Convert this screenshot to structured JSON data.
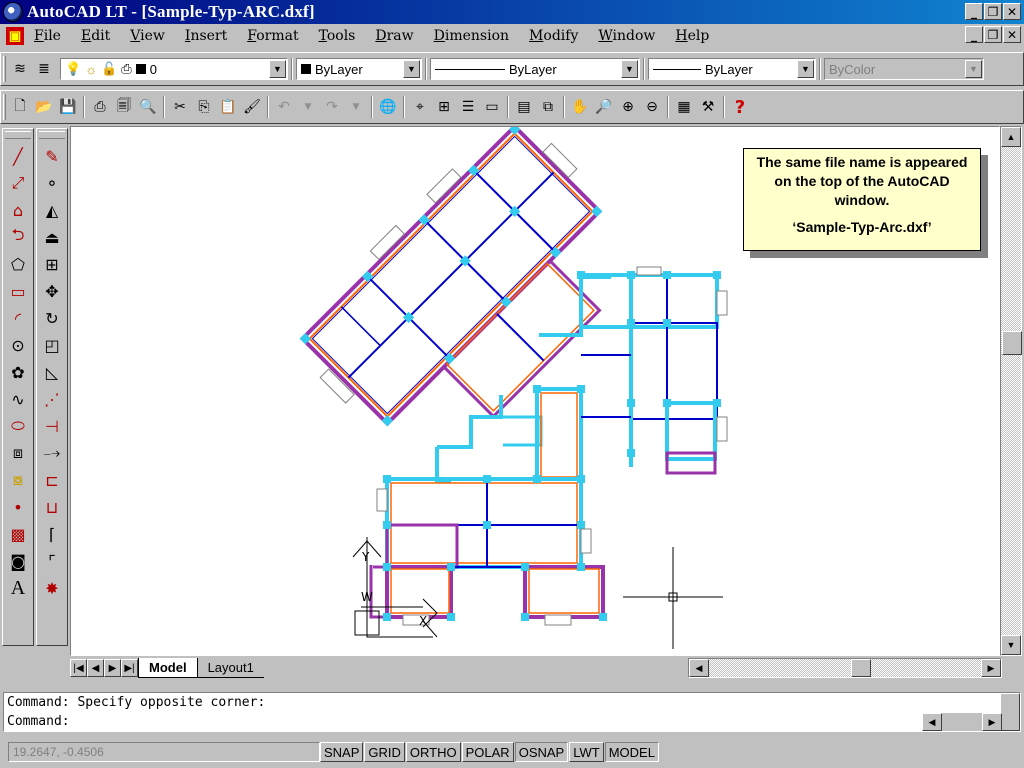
{
  "window": {
    "title": "AutoCAD LT - [Sample-Typ-ARC.dxf]",
    "controls": [
      "_",
      "❐",
      "✕"
    ]
  },
  "menu": {
    "items": [
      "File",
      "Edit",
      "View",
      "Insert",
      "Format",
      "Tools",
      "Draw",
      "Dimension",
      "Modify",
      "Window",
      "Help"
    ]
  },
  "properties": {
    "layer": "0",
    "color": "ByLayer",
    "linetype": "ByLayer",
    "lineweight": "ByLayer",
    "plotstyle": "ByColor"
  },
  "callout": {
    "line1": "The same file name is appeared on the top of the AutoCAD window.",
    "line2": "‘Sample-Typ-Arc.dxf’"
  },
  "tabs": [
    "Model",
    "Layout1"
  ],
  "command": {
    "history": "Command: Specify opposite corner:",
    "prompt": "Command:"
  },
  "status": {
    "coords": "19.2647, -0.4506",
    "toggles": [
      "SNAP",
      "GRID",
      "ORTHO",
      "POLAR",
      "OSNAP",
      "LWT",
      "MODEL"
    ],
    "pressed": [
      "OSNAP",
      "MODEL"
    ]
  },
  "ucs": {
    "y": "Y",
    "w": "W",
    "x": "X"
  },
  "colors": {
    "title_start": "#000080",
    "title_end": "#1084d0",
    "wall_cyan": "#33ccee",
    "wall_purple": "#9933aa",
    "wall_orange": "#ff6600",
    "wall_blue": "#0000cc"
  },
  "icons": {
    "help": "question-mark-icon"
  }
}
